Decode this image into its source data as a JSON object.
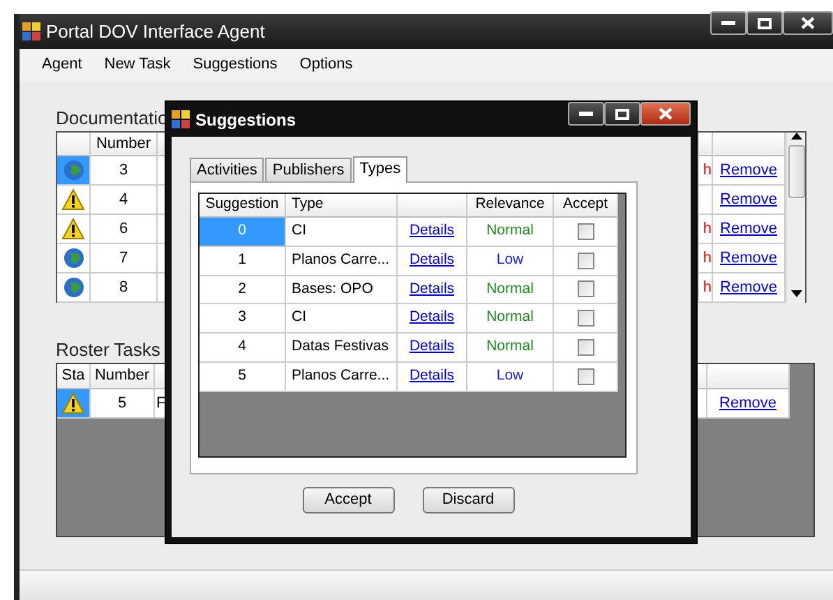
{
  "main_window": {
    "title": "Portal DOV Interface Agent"
  },
  "menu": [
    "Agent",
    "New Task",
    "Suggestions",
    "Options"
  ],
  "documentation": {
    "label": "Documentatio",
    "columns": [
      "Number"
    ],
    "rows": [
      {
        "kind": "globe",
        "selected": true,
        "number": "3",
        "column_4": "h",
        "action": "Remove"
      },
      {
        "kind": "warning",
        "selected": false,
        "number": "4",
        "action": "Remove"
      },
      {
        "kind": "warning",
        "selected": false,
        "number": "6",
        "column_4": "h",
        "action": "Remove"
      },
      {
        "kind": "globe",
        "selected": false,
        "number": "7",
        "column_4": "h",
        "action": "Remove"
      },
      {
        "kind": "globe",
        "selected": false,
        "number": "8",
        "column_4": "h",
        "action": "Remove"
      }
    ]
  },
  "roster_tasks": {
    "label": "Roster Tasks",
    "columns": [
      "Sta",
      "Number"
    ],
    "rows": [
      {
        "kind": "warning",
        "selected": true,
        "number": "5",
        "column_3": "F",
        "action": "Remove"
      }
    ]
  },
  "dialog": {
    "title": "Suggestions",
    "tabs": [
      {
        "label": "Activities",
        "selected": false
      },
      {
        "label": "Publishers",
        "selected": false
      },
      {
        "label": "Types",
        "selected": true
      }
    ],
    "columns": {
      "suggestion": "Suggestion",
      "type": "Type",
      "relevance": "Relevance",
      "accept": "Accept"
    },
    "rows": [
      {
        "suggestion": "0",
        "type": "CI",
        "link": "Details",
        "relevance": "Normal",
        "color": "#1e8c1e",
        "accept": false,
        "selected": true
      },
      {
        "suggestion": "1",
        "type": "Planos Carre...",
        "link": "Details",
        "relevance": "Low",
        "color": "#1a1aee",
        "accept": false,
        "selected": false
      },
      {
        "suggestion": "2",
        "type": "Bases: OPO",
        "link": "Details",
        "relevance": "Normal",
        "color": "#1e8c1e",
        "accept": false,
        "selected": false
      },
      {
        "suggestion": "3",
        "type": "CI",
        "link": "Details",
        "relevance": "Normal",
        "color": "#1e8c1e",
        "accept": false,
        "selected": false
      },
      {
        "suggestion": "4",
        "type": "Datas Festivas",
        "link": "Details",
        "relevance": "Normal",
        "color": "#1e8c1e",
        "accept": false,
        "selected": false
      },
      {
        "suggestion": "5",
        "type": "Planos Carre...",
        "link": "Details",
        "relevance": "Low",
        "color": "#1a1aee",
        "accept": false,
        "selected": false
      }
    ],
    "buttons": [
      "Accept",
      "Discard"
    ]
  }
}
